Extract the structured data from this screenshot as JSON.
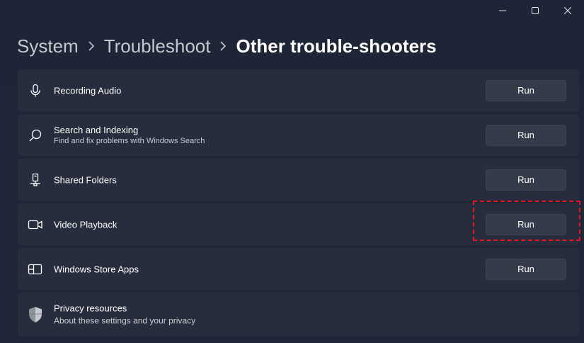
{
  "window": {
    "controls": [
      "minimize-icon",
      "maximize-icon",
      "close-icon"
    ]
  },
  "breadcrumb": {
    "items": [
      "System",
      "Troubleshoot",
      "Other trouble-shooters"
    ]
  },
  "troubleshooters": [
    {
      "icon": "microphone-icon",
      "title": "Recording Audio",
      "description": "",
      "button": "Run"
    },
    {
      "icon": "search-icon",
      "title": "Search and Indexing",
      "description": "Find and fix problems with Windows Search",
      "button": "Run"
    },
    {
      "icon": "shared-folder-icon",
      "title": "Shared Folders",
      "description": "",
      "button": "Run"
    },
    {
      "icon": "video-camera-icon",
      "title": "Video Playback",
      "description": "",
      "button": "Run"
    },
    {
      "icon": "store-app-icon",
      "title": "Windows Store Apps",
      "description": "",
      "button": "Run"
    }
  ],
  "privacy": {
    "icon": "shield-icon",
    "title": "Privacy resources",
    "description": "About these settings and your privacy"
  },
  "highlight_color": "#e8161c"
}
